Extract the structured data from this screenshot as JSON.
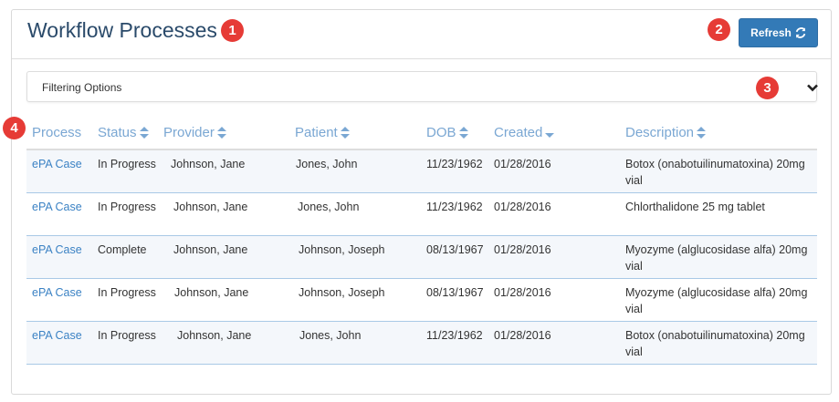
{
  "title": "Workflow Processes",
  "refresh_label": "Refresh",
  "filter_label": "Filtering Options",
  "badges": [
    "1",
    "2",
    "3",
    "4"
  ],
  "columns": [
    "Process",
    "Status",
    "Provider",
    "Patient",
    "DOB",
    "Created",
    "Description"
  ],
  "rows": [
    {
      "process": "ePA Case",
      "status": "In Progress",
      "provider": "Johnson, Jane",
      "patient": "Jones, John",
      "dob": "11/23/1962",
      "created": "01/28/2016",
      "description": "Botox (onabotuilinumatoxina) 20mg vial"
    },
    {
      "process": "ePA Case",
      "status": "In Progress",
      "provider": "Johnson, Jane",
      "patient": "Jones, John",
      "dob": "11/23/1962",
      "created": "01/28/2016",
      "description": "Chlorthalidone 25 mg tablet"
    },
    {
      "process": "ePA Case",
      "status": "Complete",
      "provider": "Johnson, Jane",
      "patient": "Johnson, Joseph",
      "dob": "08/13/1967",
      "created": "01/28/2016",
      "description": "Myozyme (alglucosidase alfa) 20mg vial"
    },
    {
      "process": "ePA Case",
      "status": "In Progress",
      "provider": "Johnson, Jane",
      "patient": "Johnson, Joseph",
      "dob": "08/13/1967",
      "created": "01/28/2016",
      "description": "Myozyme (alglucosidase alfa) 20mg vial"
    },
    {
      "process": "ePA Case",
      "status": "In Progress",
      "provider": "Johnson, Jane",
      "patient": "Jones, John",
      "dob": "11/23/1962",
      "created": "01/28/2016",
      "description": "Botox (onabotuilinumatoxina) 20mg vial"
    }
  ],
  "icons": {
    "refresh": "refresh-icon",
    "expand": "chevron-down-icon",
    "sort": "sort-icon",
    "sort_active": "sort-desc-icon"
  },
  "colors": {
    "title": "#2a4a6a",
    "primary_button": "#337ab7",
    "badge": "#e63b36",
    "header_link": "#7aa7d3",
    "row_link": "#3b82c4"
  }
}
